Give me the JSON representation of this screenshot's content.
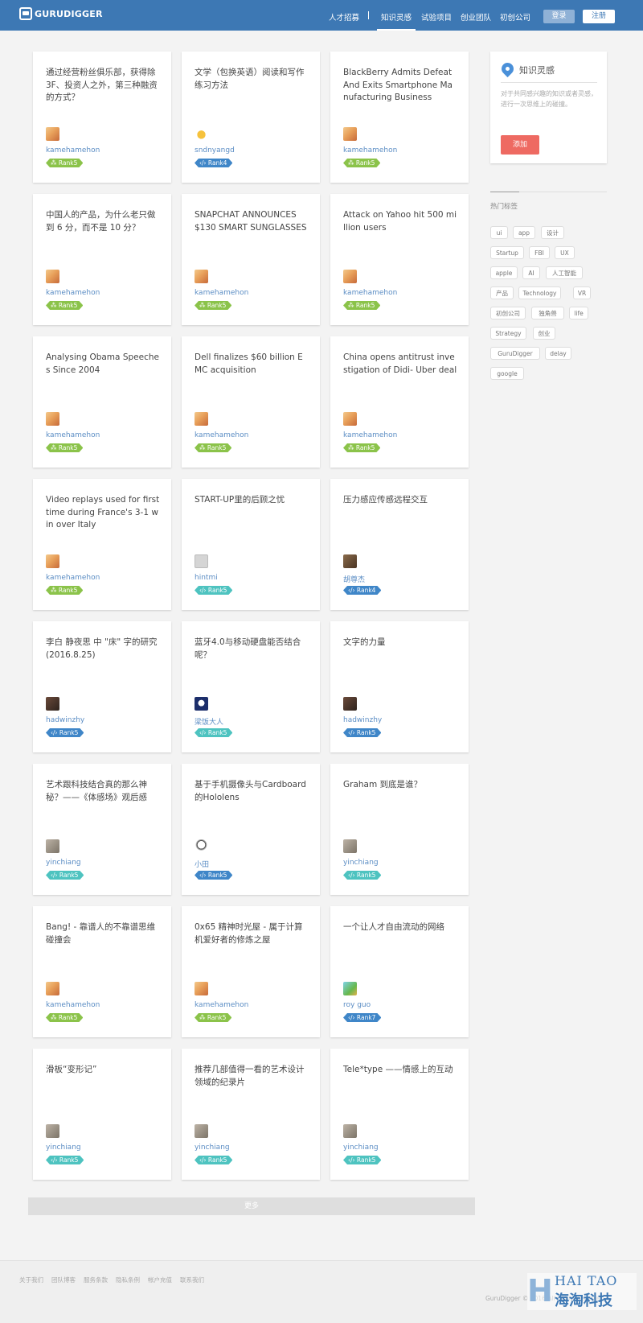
{
  "header": {
    "logo_text": "GURUDIGGER",
    "nav": [
      "人才招募",
      "知识灵感",
      "试验项目",
      "创业团队",
      "初创公司"
    ],
    "active_nav": "知识灵感",
    "login_label": "登录",
    "register_label": "注册"
  },
  "cards": [
    {
      "title": "通过经营粉丝俱乐部，获得除3F、投资人之外，第三种融资的方式？",
      "author": "kamehamehon",
      "rank": "Rank5",
      "rank_color": "green",
      "avatar": "a"
    },
    {
      "title": "文学（包换英语）阅读和写作练习方法",
      "author": "sndnyangd",
      "rank": "Rank4",
      "rank_color": "blue",
      "avatar": "b"
    },
    {
      "title": "BlackBerry Admits Defeat And Exits Smartphone Manufacturing Business",
      "author": "kamehamehon",
      "rank": "Rank5",
      "rank_color": "green",
      "avatar": "a"
    },
    {
      "title": "中国人的产品，为什么老只做到 6 分，而不是 10 分？",
      "author": "kamehamehon",
      "rank": "Rank5",
      "rank_color": "green",
      "avatar": "a"
    },
    {
      "title": "SNAPCHAT ANNOUNCES $130 SMART SUNGLASSES",
      "author": "kamehamehon",
      "rank": "Rank5",
      "rank_color": "green",
      "avatar": "a"
    },
    {
      "title": "Attack on Yahoo hit 500 million users",
      "author": "kamehamehon",
      "rank": "Rank5",
      "rank_color": "green",
      "avatar": "a"
    },
    {
      "title": "Analysing Obama Speeches Since 2004",
      "author": "kamehamehon",
      "rank": "Rank5",
      "rank_color": "green",
      "avatar": "a"
    },
    {
      "title": "Dell finalizes $60 billion EMC acquisition",
      "author": "kamehamehon",
      "rank": "Rank5",
      "rank_color": "green",
      "avatar": "a"
    },
    {
      "title": "China opens antitrust investigation of Didi- Uber deal",
      "author": "kamehamehon",
      "rank": "Rank5",
      "rank_color": "green",
      "avatar": "a"
    },
    {
      "title": "Video replays used for first time during France's 3-1 win over Italy",
      "author": "kamehamehon",
      "rank": "Rank5",
      "rank_color": "green",
      "avatar": "a"
    },
    {
      "title": "START-UP里的后顾之忧",
      "author": "hintmi",
      "rank": "Rank5",
      "rank_color": "teal",
      "avatar": "c"
    },
    {
      "title": "压力感应传感远程交互",
      "author": "胡尊杰",
      "rank": "Rank4",
      "rank_color": "blue",
      "avatar": "d"
    },
    {
      "title": "李白 静夜思 中 \"床\" 字的研究 (2016.8.25)",
      "author": "hadwinzhy",
      "rank": "Rank5",
      "rank_color": "blue",
      "avatar": "e"
    },
    {
      "title": "蓝牙4.0与移动硬盘能否结合呢？",
      "author": "梁饭大人",
      "rank": "Rank5",
      "rank_color": "teal",
      "avatar": "f"
    },
    {
      "title": "文字的力量",
      "author": "hadwinzhy",
      "rank": "Rank5",
      "rank_color": "blue",
      "avatar": "e"
    },
    {
      "title": "艺术跟科技结合真的那么神秘？——《体感场》观后感",
      "author": "yinchiang",
      "rank": "Rank5",
      "rank_color": "teal",
      "avatar": "g"
    },
    {
      "title": "基于手机摄像头与Cardboard的Hololens",
      "author": "小田",
      "rank": "Rank5",
      "rank_color": "blue",
      "avatar": "h"
    },
    {
      "title": "Graham 到底是谁？",
      "author": "yinchiang",
      "rank": "Rank5",
      "rank_color": "teal",
      "avatar": "g"
    },
    {
      "title": "Bang! - 靠谱人的不靠谱思维碰撞会",
      "author": "kamehamehon",
      "rank": "Rank5",
      "rank_color": "green",
      "avatar": "a"
    },
    {
      "title": "0x65 精神时光屋 - 属于计算机爱好者的修炼之屋",
      "author": "kamehamehon",
      "rank": "Rank5",
      "rank_color": "green",
      "avatar": "a"
    },
    {
      "title": "一个让人才自由流动的网络",
      "author": "roy guo",
      "rank": "Rank7",
      "rank_color": "blue",
      "avatar": "i"
    },
    {
      "title": "滑板“变形记”",
      "author": "yinchiang",
      "rank": "Rank5",
      "rank_color": "teal",
      "avatar": "g"
    },
    {
      "title": "推荐几部值得一看的艺术设计领域的纪录片",
      "author": "yinchiang",
      "rank": "Rank5",
      "rank_color": "teal",
      "avatar": "g"
    },
    {
      "title": "Tele*type ——情感上的互动",
      "author": "yinchiang",
      "rank": "Rank5",
      "rank_color": "teal",
      "avatar": "g"
    }
  ],
  "sidebar": {
    "title": "知识灵感",
    "description": "对于共同感兴趣的知识或者灵感，进行一次思维上的碰撞。",
    "add_label": "添加",
    "tags_title": "热门标签",
    "tags": [
      "ui",
      "app",
      "设计",
      "Startup",
      "FBI",
      "UX",
      "apple",
      "AI",
      "人工智能",
      "产品",
      "Technology",
      "VR",
      "初创公司",
      "独角兽",
      "life",
      "Strategy",
      "创业",
      "GuruDigger",
      "delay",
      "google"
    ]
  },
  "more_label": "更多",
  "footer": {
    "links": [
      "关于我们",
      "团队博客",
      "服务条款",
      "隐私条例",
      "帐户充值",
      "联系我们"
    ],
    "copyright": "GuruDigger © 2016 All rights reserved"
  },
  "watermark": {
    "line1": "HAI TAO",
    "line2": "海淘科技"
  },
  "colors": {
    "header": "#3d78b4",
    "rank_green": "#8bc34a",
    "rank_blue": "#3f86c8",
    "rank_teal": "#4ec3c0",
    "add_button": "#ee6a62"
  }
}
